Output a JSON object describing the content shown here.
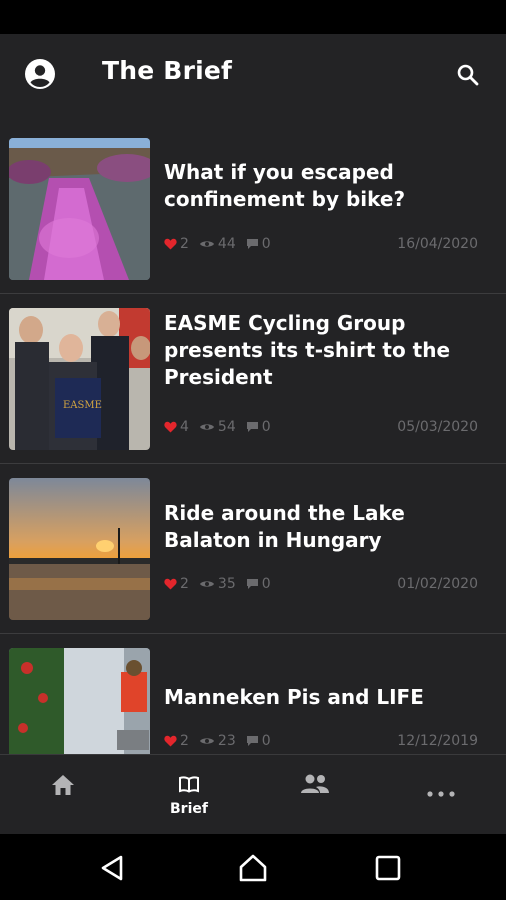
{
  "app": {
    "title": "The Brief"
  },
  "icons": {
    "account": "account-circle-icon",
    "search": "search-icon",
    "likes": "heart-icon",
    "views": "eye-icon",
    "comments": "comment-icon"
  },
  "colors": {
    "background": "#232325",
    "heart": "#e3262c",
    "meta_text": "#6b6b6e"
  },
  "articles": [
    {
      "title": "What if you escaped confinement by bike?",
      "likes": "2",
      "views": "44",
      "comments": "0",
      "date": "16/04/2020"
    },
    {
      "title": "EASME Cycling Group presents its t-shirt to the President",
      "likes": "4",
      "views": "54",
      "comments": "0",
      "date": "05/03/2020"
    },
    {
      "title": "Ride around the Lake Balaton in Hungary",
      "likes": "2",
      "views": "35",
      "comments": "0",
      "date": "01/02/2020"
    },
    {
      "title": "Manneken Pis and LIFE",
      "likes": "2",
      "views": "23",
      "comments": "0",
      "date": "12/12/2019"
    }
  ],
  "bottom_nav": {
    "items": [
      {
        "icon": "home-icon",
        "label": ""
      },
      {
        "icon": "book-icon",
        "label": "Brief",
        "active": true
      },
      {
        "icon": "people-icon",
        "label": ""
      },
      {
        "icon": "more-icon",
        "label": ""
      }
    ]
  },
  "system_nav": [
    "back-icon",
    "home-button-icon",
    "recents-icon"
  ]
}
